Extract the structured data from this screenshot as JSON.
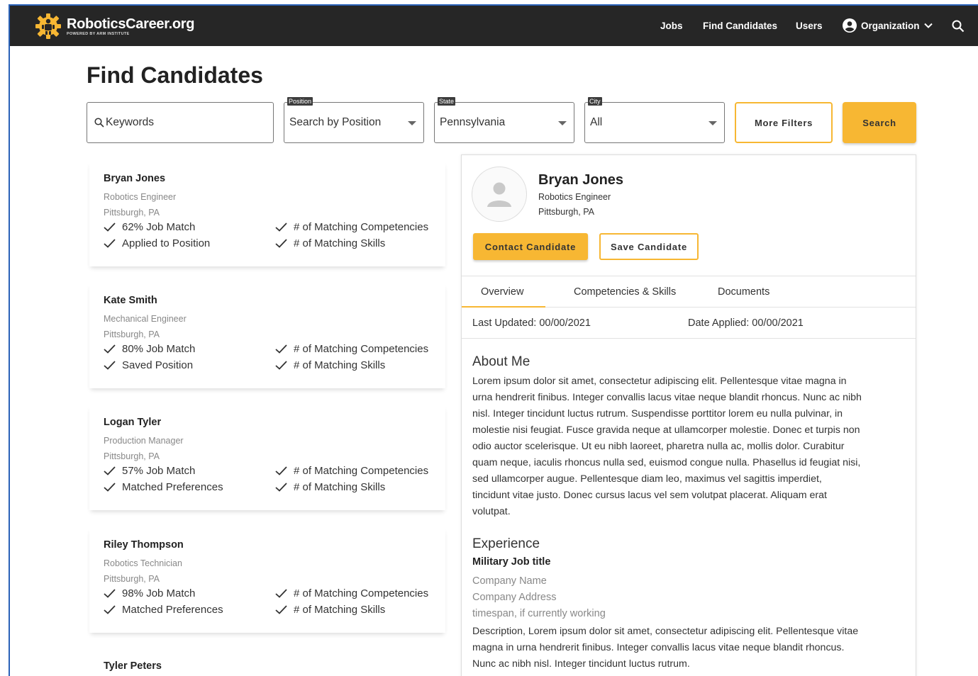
{
  "brand": {
    "name": "RoboticsCareer.org",
    "tagline": "POWERED BY ARM INSTITUTE"
  },
  "nav": {
    "jobs": "Jobs",
    "find_candidates": "Find Candidates",
    "users": "Users",
    "organization": "Organization"
  },
  "page_title": "Find Candidates",
  "filters": {
    "keywords_placeholder": "Keywords",
    "position": {
      "label": "Position",
      "value": "Search by Position"
    },
    "state": {
      "label": "State",
      "value": "Pennsylvania"
    },
    "city": {
      "label": "City",
      "value": "All"
    },
    "more_filters": "More Filters",
    "search": "Search"
  },
  "candidates": [
    {
      "name": "Bryan Jones",
      "role": "Robotics Engineer",
      "location": "Pittsburgh, PA",
      "match": "62% Job Match",
      "status": "Applied to Position",
      "competencies": "# of Matching Competencies",
      "skills": "# of Matching Skills"
    },
    {
      "name": "Kate Smith",
      "role": "Mechanical Engineer",
      "location": "Pittsburgh, PA",
      "match": "80% Job Match",
      "status": "Saved Position",
      "competencies": "# of Matching Competencies",
      "skills": "# of Matching Skills"
    },
    {
      "name": "Logan Tyler",
      "role": "Production Manager",
      "location": "Pittsburgh, PA",
      "match": "57% Job Match",
      "status": "Matched Preferences",
      "competencies": "# of Matching Competencies",
      "skills": "# of Matching Skills"
    },
    {
      "name": "Riley Thompson",
      "role": "Robotics Technician",
      "location": "Pittsburgh, PA",
      "match": "98% Job Match",
      "status": "Matched Preferences",
      "competencies": "# of Matching Competencies",
      "skills": "# of Matching Skills"
    },
    {
      "name": "Tyler Peters"
    }
  ],
  "detail": {
    "name": "Bryan Jones",
    "role": "Robotics Engineer",
    "location": "Pittsburgh, PA",
    "contact_button": "Contact Candidate",
    "save_button": "Save Candidate",
    "tabs": [
      "Overview",
      "Competencies & Skills",
      "Documents"
    ],
    "last_updated": "Last Updated: 00/00/2021",
    "date_applied": "Date Applied: 00/00/2021",
    "about_title": "About Me",
    "about_lines": [
      "Lorem ipsum dolor sit amet, consectetur adipiscing elit. Pellentesque vitae magna in",
      "urna hendrerit finibus. Integer convallis lacus vitae neque blandit rhoncus. Nunc ac nibh",
      "nisl. Integer tincidunt luctus rutrum. Suspendisse porttitor lorem eu nulla pulvinar, in",
      "molestie nisi feugiat. Fusce gravida neque at ullamcorper molestie. Donec et turpis non",
      "odio auctor scelerisque. Ut eu nibh laoreet, pharetra nulla ac, mollis dolor. Curabitur",
      "quam neque, iaculis rhoncus nulla sed, euismod congue nulla. Phasellus id feugiat nisi,",
      "sed ullamcorper augue. Pellentesque diam leo, maximus vel sagittis imperdiet,",
      "tincidunt vitae justo. Donec cursus lacus vel sem volutpat placerat. Aliquam erat",
      "volutpat."
    ],
    "experience_title": "Experience",
    "experience": {
      "job_title": "Military Job title",
      "company": "Company Name",
      "address": "Company Address",
      "timespan": "timespan, if currently working",
      "description_lines": [
        "Description, Lorem ipsum dolor sit amet, consectetur adipiscing elit. Pellentesque vitae",
        "magna in urna hendrerit finibus. Integer convallis lacus vitae neque blandit rhoncus.",
        "Nunc ac nibh nisl. Integer tincidunt luctus rutrum."
      ]
    }
  },
  "colors": {
    "nav_bg": "#262626",
    "accent": "#f7b733"
  }
}
